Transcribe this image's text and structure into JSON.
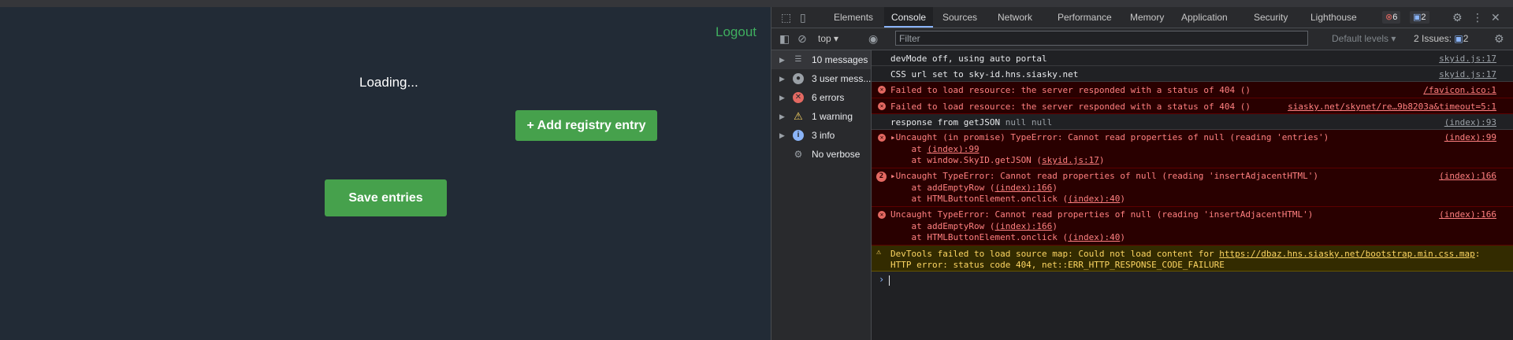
{
  "app": {
    "logout": "Logout",
    "loading": "Loading...",
    "add_button": "+ Add registry entry",
    "save_button": "Save entries"
  },
  "devtools": {
    "tabs": [
      "Elements",
      "Console",
      "Sources",
      "Network",
      "Performance",
      "Memory",
      "Application",
      "Security",
      "Lighthouse"
    ],
    "error_count": "6",
    "message_count": "2",
    "context": "top",
    "filter_placeholder": "Filter",
    "levels": "Default levels",
    "issues": "2 Issues:",
    "issues_count": "2",
    "sidebar": [
      {
        "label": "10 messages"
      },
      {
        "label": "3 user mess..."
      },
      {
        "label": "6 errors"
      },
      {
        "label": "1 warning"
      },
      {
        "label": "3 info"
      },
      {
        "label": "No verbose"
      }
    ],
    "messages": [
      {
        "text": "devMode off, using auto portal",
        "source": "skyid.js:17"
      },
      {
        "text": "CSS url set to sky-id.hns.siasky.net",
        "source": "skyid.js:17"
      },
      {
        "text": "Failed to load resource: the server responded with a status of 404 ()",
        "source": "/favicon.ico:1"
      },
      {
        "text": "Failed to load resource: the server responded with a status of 404 ()",
        "source": "siasky.net/skynet/re…9b8203a&timeout=5:1"
      },
      {
        "text": "response from getJSON",
        "extra": "null null",
        "source": "(index):93"
      },
      {
        "l1": "▸Uncaught (in promise) TypeError: Cannot read properties of null (reading 'entries')",
        "l2a": "    at ",
        "l2b": "(index):99",
        "l3a": "    at window.SkyID.getJSON (",
        "l3b": "skyid.js:17",
        "l3c": ")",
        "source": "(index):99"
      },
      {
        "count": "2",
        "l1": "▸Uncaught TypeError: Cannot read properties of null (reading 'insertAdjacentHTML')",
        "l2a": "    at addEmptyRow (",
        "l2b": "(index):166",
        "l2c": ")",
        "l3a": "    at HTMLButtonElement.onclick (",
        "l3b": "(index):40",
        "l3c": ")",
        "source": "(index):166"
      },
      {
        "l1": "Uncaught TypeError: Cannot read properties of null (reading 'insertAdjacentHTML')",
        "l2a": "    at addEmptyRow (",
        "l2b": "(index):166",
        "l2c": ")",
        "l3a": "    at HTMLButtonElement.onclick (",
        "l3b": "(index):40",
        "l3c": ")",
        "source": "(index):166"
      },
      {
        "l1a": "DevTools failed to load source map: Could not load content for ",
        "l1b": "https://dbaz.hns.siasky.net/bootstrap.min.css.map",
        "l1c": ":",
        "l2": "HTTP error: status code 404, net::ERR_HTTP_RESPONSE_CODE_FAILURE"
      }
    ]
  }
}
